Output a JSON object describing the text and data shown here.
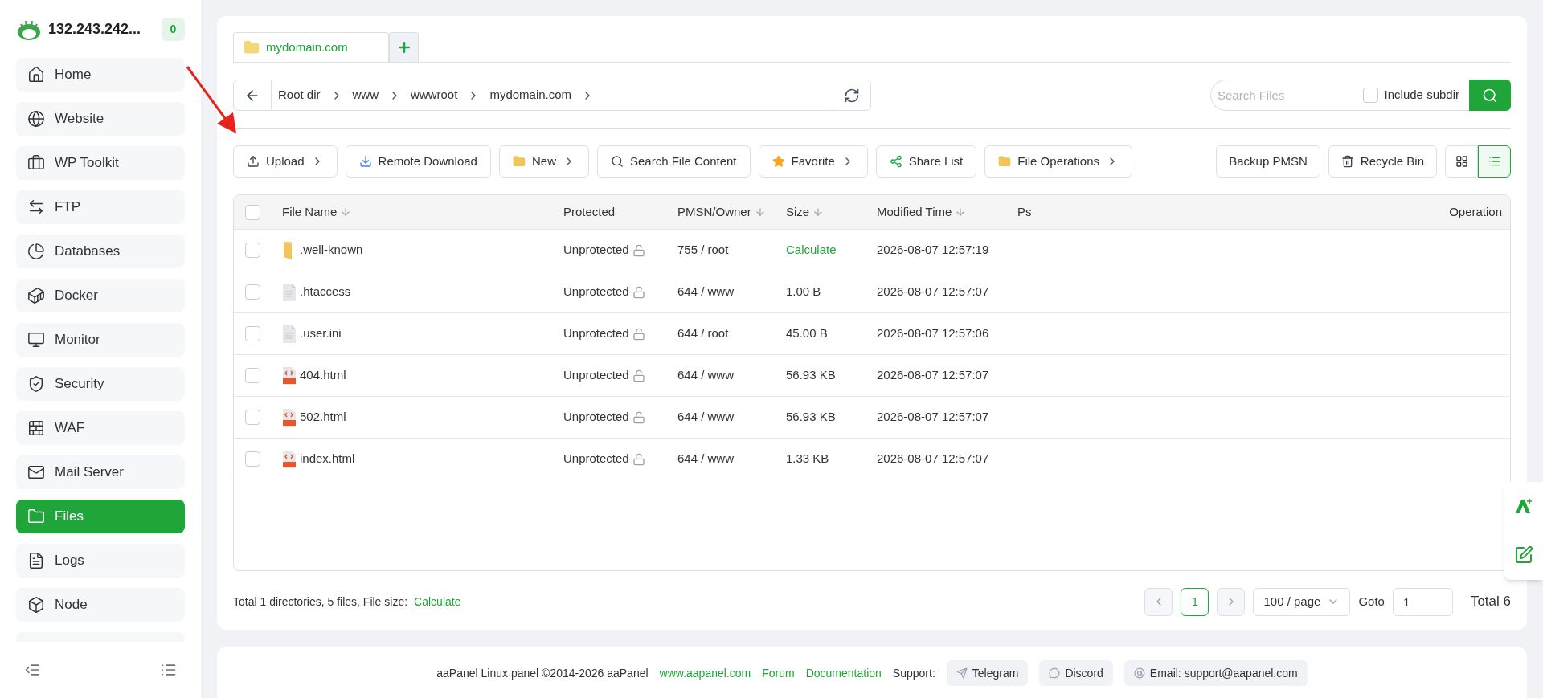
{
  "server": {
    "title": "132.243.242...",
    "badge": "0"
  },
  "sidebar": {
    "items": [
      {
        "label": "Home",
        "kind": "home",
        "selected": false
      },
      {
        "label": "Website",
        "kind": "globe",
        "selected": false
      },
      {
        "label": "WP Toolkit",
        "kind": "toolkit",
        "selected": false
      },
      {
        "label": "FTP",
        "kind": "transfer",
        "selected": false
      },
      {
        "label": "Databases",
        "kind": "pie",
        "selected": false
      },
      {
        "label": "Docker",
        "kind": "container",
        "selected": false
      },
      {
        "label": "Monitor",
        "kind": "monitor",
        "selected": false
      },
      {
        "label": "Security",
        "kind": "shield",
        "selected": false
      },
      {
        "label": "WAF",
        "kind": "firewall",
        "selected": false
      },
      {
        "label": "Mail Server",
        "kind": "mail",
        "selected": false
      },
      {
        "label": "Files",
        "kind": "folder",
        "selected": true
      },
      {
        "label": "Logs",
        "kind": "log",
        "selected": false
      },
      {
        "label": "Node",
        "kind": "cube",
        "selected": false
      }
    ]
  },
  "tabs": [
    {
      "label": "mydomain.com",
      "selected": true
    }
  ],
  "breadcrumb": [
    "Root dir",
    "www",
    "wwwroot",
    "mydomain.com"
  ],
  "search": {
    "placeholder": "Search Files",
    "include_subdir": {
      "label": "Include subdir",
      "checked": false
    }
  },
  "toolbar": [
    {
      "label": "Upload",
      "kind": "upload",
      "menu": true
    },
    {
      "label": "Remote Download",
      "kind": "download",
      "menu": false
    },
    {
      "label": "New",
      "kind": "folder",
      "menu": true
    },
    {
      "label": "Search File Content",
      "kind": "search",
      "menu": false
    },
    {
      "label": "Favorite",
      "kind": "star",
      "menu": true
    },
    {
      "label": "Share List",
      "kind": "share",
      "menu": false
    },
    {
      "label": "File Operations",
      "kind": "folder",
      "menu": true
    }
  ],
  "toolbar_right": [
    {
      "label": "Backup PMSN",
      "kind": "plain"
    },
    {
      "label": "Recycle Bin",
      "kind": "trash"
    }
  ],
  "view_modes": [
    {
      "kind": "grid",
      "selected": false
    },
    {
      "kind": "list",
      "selected": true
    }
  ],
  "table": {
    "select_all_checked": false,
    "columns": [
      {
        "label": "File Name",
        "sortable": true
      },
      {
        "label": "Protected",
        "sortable": false
      },
      {
        "label": "PMSN/Owner",
        "sortable": true
      },
      {
        "label": "Size",
        "sortable": true
      },
      {
        "label": "Modified Time",
        "sortable": true
      },
      {
        "label": "Ps",
        "sortable": false
      },
      {
        "label": "Operation",
        "sortable": false
      }
    ],
    "rows": [
      {
        "kind": "folder",
        "checked": false,
        "name": ".well-known",
        "protected": "Unprotected",
        "owner": "755 / root",
        "size": "Calculate",
        "size_link": true,
        "modified": "2026-08-07 12:57:19"
      },
      {
        "kind": "file",
        "checked": false,
        "name": ".htaccess",
        "protected": "Unprotected",
        "owner": "644 / www",
        "size": "1.00 B",
        "size_link": false,
        "modified": "2026-08-07 12:57:07"
      },
      {
        "kind": "file",
        "checked": false,
        "name": ".user.ini",
        "protected": "Unprotected",
        "owner": "644 / root",
        "size": "45.00 B",
        "size_link": false,
        "modified": "2026-08-07 12:57:06"
      },
      {
        "kind": "html",
        "checked": false,
        "name": "404.html",
        "protected": "Unprotected",
        "owner": "644 / www",
        "size": "56.93 KB",
        "size_link": false,
        "modified": "2026-08-07 12:57:07"
      },
      {
        "kind": "html",
        "checked": false,
        "name": "502.html",
        "protected": "Unprotected",
        "owner": "644 / www",
        "size": "56.93 KB",
        "size_link": false,
        "modified": "2026-08-07 12:57:07"
      },
      {
        "kind": "html",
        "checked": false,
        "name": "index.html",
        "protected": "Unprotected",
        "owner": "644 / www",
        "size": "1.33 KB",
        "size_link": false,
        "modified": "2026-08-07 12:57:07"
      }
    ]
  },
  "summary": {
    "text": "Total 1 directories, 5 files, File size:",
    "link": "Calculate"
  },
  "pagination": {
    "pages": [
      {
        "label": "1",
        "selected": true
      }
    ],
    "page_size": "100 / page",
    "goto_label": "Goto",
    "goto_value": "1",
    "total": "Total 6"
  },
  "footer": {
    "text": "aaPanel Linux panel ©2014-2026 aaPanel",
    "links": [
      "www.aapanel.com",
      "Forum",
      "Documentation"
    ],
    "support_label": "Support:",
    "chips": [
      {
        "label": "Telegram",
        "kind": "telegram"
      },
      {
        "label": "Discord",
        "kind": "discord"
      },
      {
        "label": "Email: support@aapanel.com",
        "kind": "email"
      }
    ]
  }
}
